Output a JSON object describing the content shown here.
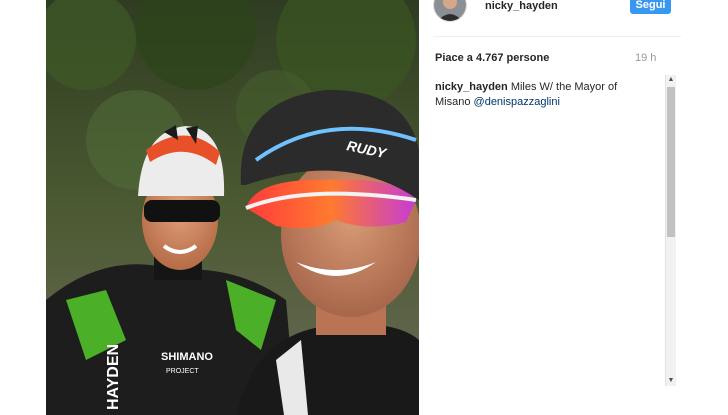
{
  "post": {
    "username": "nicky_hayden",
    "follow_label": "Segui",
    "likes": "Piace a 4.767 persone",
    "time": "19 h",
    "caption": {
      "username": "nicky_hayden",
      "text": " Miles W/ the Mayor of Misano ",
      "mention": "@denispazzaglini"
    }
  },
  "photo": {
    "helmet_brand": "RUDY",
    "jersey_text": "SHIMANO",
    "jersey_text_2": "HAYDEN",
    "jersey_text_3": "PROJECT"
  },
  "colors": {
    "follow_button": "#3897f0",
    "mention": "#003569",
    "meta": "#999999"
  }
}
